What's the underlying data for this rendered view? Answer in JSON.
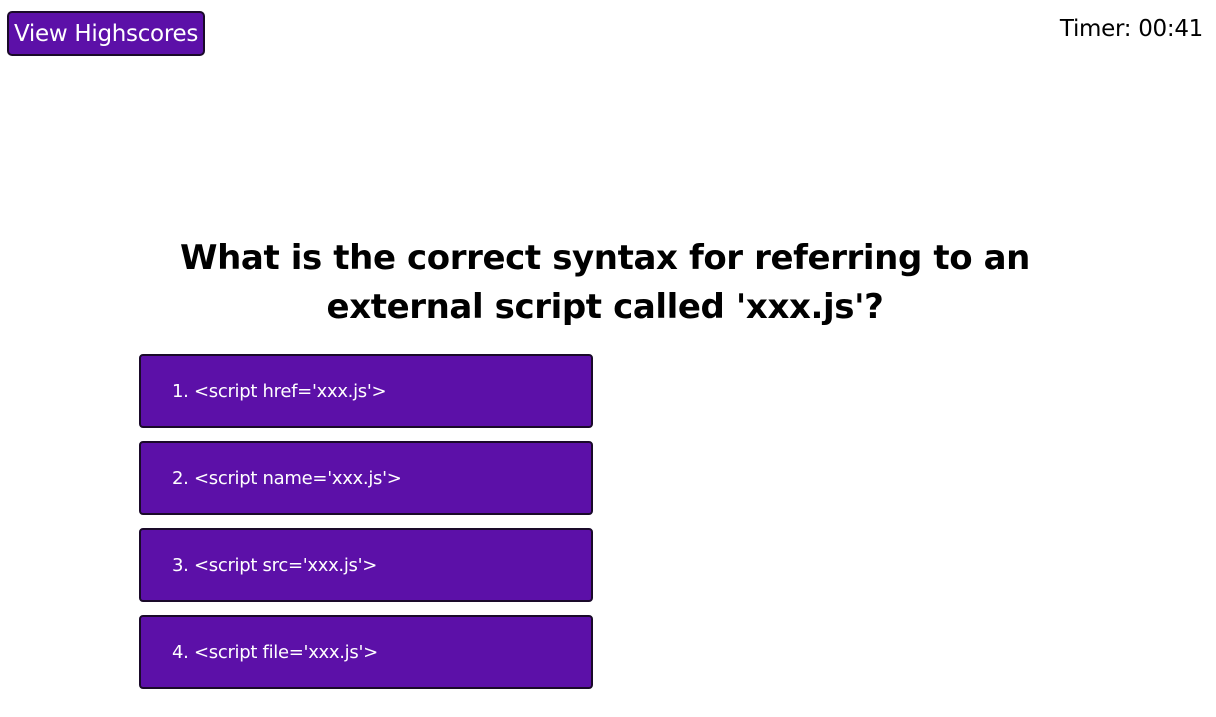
{
  "header": {
    "highscores_label": "View Highscores",
    "timer_text": "Timer: 00:41"
  },
  "quiz": {
    "question": "What is the correct syntax for referring to an external script called 'xxx.js'?",
    "choices": [
      "1. <script href='xxx.js'>",
      "2. <script name='xxx.js'>",
      "3. <script src='xxx.js'>",
      "4. <script file='xxx.js'>"
    ]
  },
  "colors": {
    "accent": "#5c10a8",
    "button_border": "#1a0a2a"
  }
}
